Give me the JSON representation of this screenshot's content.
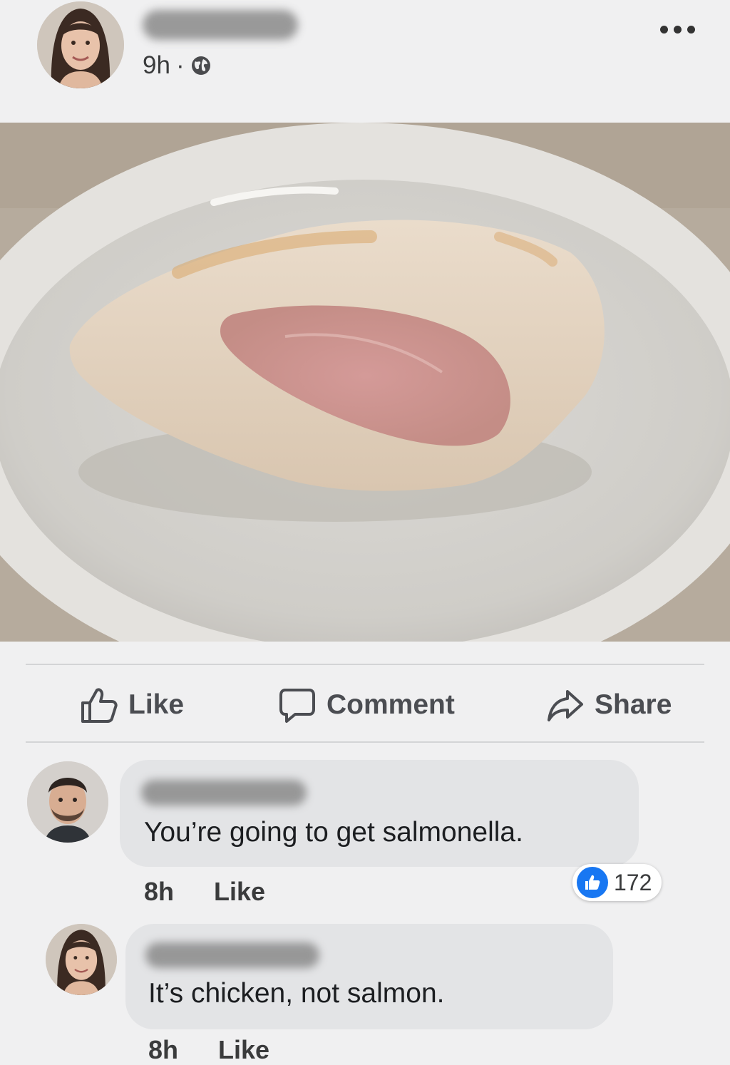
{
  "post": {
    "time": "9h",
    "separator": "·",
    "audience_icon": "globe-icon",
    "more_icon": "more-dots-icon"
  },
  "actions": {
    "like_label": "Like",
    "comment_label": "Comment",
    "share_label": "Share"
  },
  "comments": [
    {
      "text": "You’re going to get salmonella.",
      "time": "8h",
      "like_label": "Like",
      "reaction_count": "172",
      "reaction_icon": "thumbs-up-icon"
    },
    {
      "text": "It’s chicken, not salmon.",
      "time": "8h",
      "like_label": "Like"
    }
  ],
  "colors": {
    "accent": "#1877f2",
    "bubble": "#e3e4e6",
    "background": "#f0f0f1"
  }
}
